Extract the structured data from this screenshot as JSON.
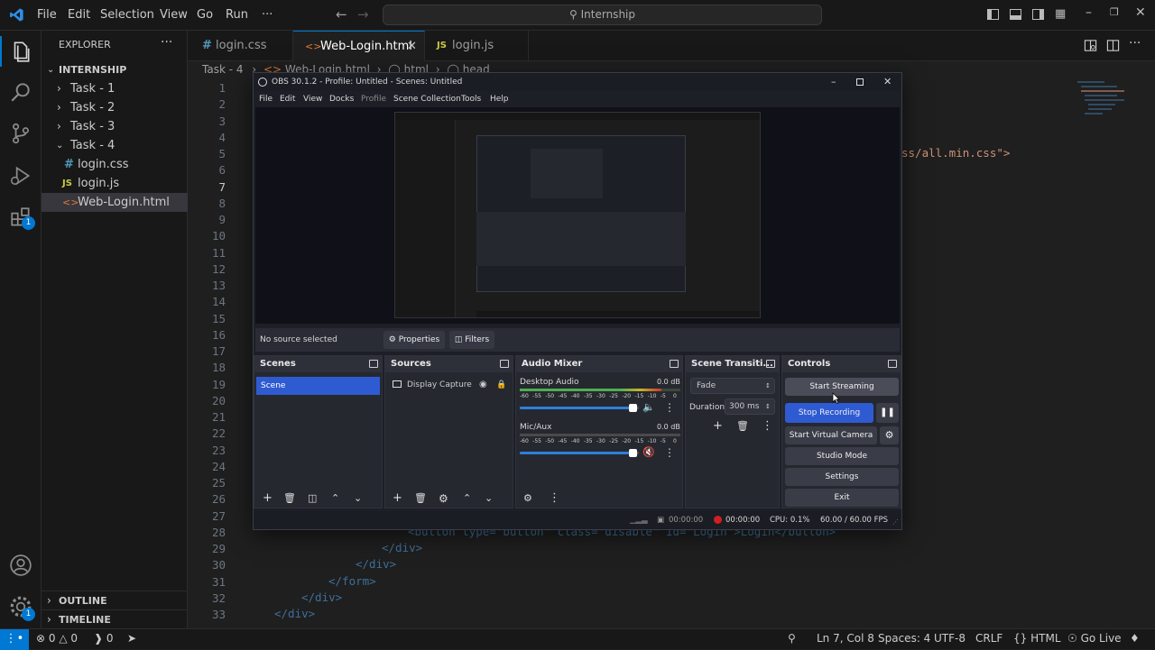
{
  "vscode": {
    "menu": [
      "File",
      "Edit",
      "Selection",
      "View",
      "Go",
      "Run",
      "···"
    ],
    "search": "Internship",
    "explorer": {
      "title": "EXPLORER",
      "root": "INTERNSHIP",
      "items": [
        {
          "label": "Task - 1",
          "kind": "folder-closed"
        },
        {
          "label": "Task - 2",
          "kind": "folder-closed"
        },
        {
          "label": "Task - 3",
          "kind": "folder-closed"
        },
        {
          "label": "Task - 4",
          "kind": "folder-open"
        },
        {
          "label": "login.css",
          "kind": "css"
        },
        {
          "label": "login.js",
          "kind": "js"
        },
        {
          "label": "Web-Login.html",
          "kind": "html",
          "selected": true
        }
      ],
      "outline": "OUTLINE",
      "timeline": "TIMELINE"
    },
    "tabs": [
      {
        "label": "login.css",
        "icon": "#"
      },
      {
        "label": "Web-Login.html",
        "icon": "<>",
        "active": true
      },
      {
        "label": "login.js",
        "icon": "JS"
      }
    ],
    "breadcrumb": [
      "Task - 4",
      "Web-Login.html",
      "html",
      "head"
    ],
    "line_numbers": [
      "1",
      "2",
      "3",
      "4",
      "5",
      "6",
      "7",
      "8",
      "9",
      "10",
      "11",
      "12",
      "13",
      "14",
      "15",
      "16",
      "17",
      "18",
      "19",
      "20",
      "21",
      "22",
      "23",
      "24",
      "25",
      "26",
      "27",
      "28",
      "29",
      "30",
      "31",
      "32",
      "33"
    ],
    "current_line": "7",
    "code_visible": {
      "css_link_tail": "ss/all.min.css\">",
      "line28": "<button type=\"button\" class=\"disable\" id=\"Login\">Login</button>",
      "line29": "</div>",
      "line30": "</div>",
      "line31": "</form>",
      "line32": "</div>",
      "line33": "</div>"
    },
    "status": {
      "errors": "0",
      "warnings": "0",
      "ports": "0",
      "position": "Ln 7, Col 8",
      "spaces": "Spaces: 4",
      "encoding": "UTF-8",
      "eol": "CRLF",
      "language": "HTML",
      "golive": "Go Live"
    },
    "badges": {
      "extensions": "1",
      "settings": "1"
    }
  },
  "obs": {
    "title": "OBS 30.1.2 - Profile: Untitled - Scenes: Untitled",
    "menu": [
      "File",
      "Edit",
      "View",
      "Docks",
      "Profile",
      "Scene Collection",
      "Tools",
      "Help"
    ],
    "no_source": "No source selected",
    "properties": "Properties",
    "filters": "Filters",
    "scenes": {
      "title": "Scenes",
      "items": [
        "Scene"
      ]
    },
    "sources": {
      "title": "Sources",
      "items": [
        "Display Capture"
      ]
    },
    "mixer": {
      "title": "Audio Mixer",
      "channels": [
        {
          "name": "Desktop Audio",
          "db": "0.0 dB",
          "level": 0.88,
          "volume": 0.96
        },
        {
          "name": "Mic/Aux",
          "db": "0.0 dB",
          "level": 0.0,
          "volume": 0.96
        }
      ],
      "scale": [
        "-60",
        "-55",
        "-50",
        "-45",
        "-40",
        "-35",
        "-30",
        "-25",
        "-20",
        "-15",
        "-10",
        "-5",
        "0"
      ]
    },
    "transitions": {
      "title": "Scene Transiti...",
      "value": "Fade",
      "duration_label": "Duration",
      "duration": "300 ms"
    },
    "controls": {
      "title": "Controls",
      "start_streaming": "Start Streaming",
      "stop_recording": "Stop Recording",
      "start_virtual_camera": "Start Virtual Camera",
      "studio_mode": "Studio Mode",
      "settings": "Settings",
      "exit": "Exit"
    },
    "status": {
      "stream_time": "00:00:00",
      "rec_time": "00:00:00",
      "cpu": "CPU: 0.1%",
      "fps": "60.00 / 60.00 FPS"
    },
    "colors": {
      "accent": "#2f5bd2",
      "record": "#d11f1f",
      "meter_green": "#4caf50",
      "meter_yellow": "#c6b628",
      "meter_red": "#c63a2a"
    }
  }
}
